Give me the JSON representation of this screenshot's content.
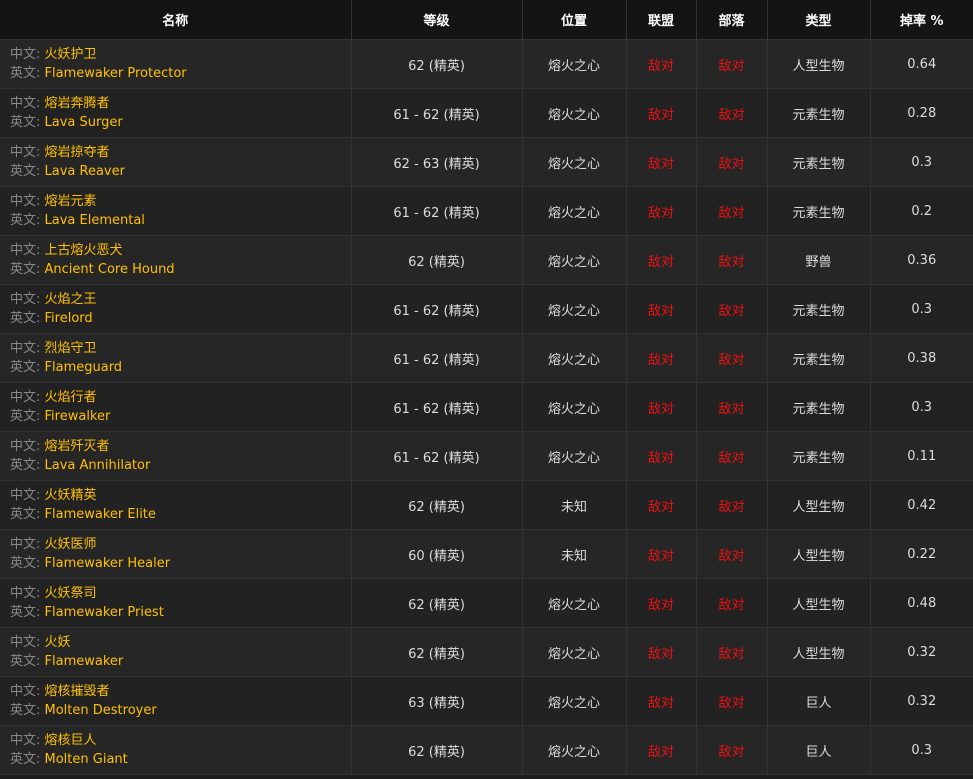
{
  "headers": {
    "name": "名称",
    "level": "等级",
    "location": "位置",
    "alliance": "联盟",
    "horde": "部落",
    "type": "类型",
    "drop": "掉率 %"
  },
  "labels": {
    "cn": "中文: ",
    "en": "英文: "
  },
  "colors": {
    "name": "#ffc000",
    "hostile": "#ee1111",
    "label": "#888888"
  },
  "rows": [
    {
      "cn": "火妖护卫",
      "en": "Flamewaker Protector",
      "level": "62 (精英)",
      "location": "熔火之心",
      "alliance": "敌对",
      "horde": "敌对",
      "type": "人型生物",
      "drop": "0.64"
    },
    {
      "cn": "熔岩奔腾者",
      "en": "Lava Surger",
      "level": "61 - 62 (精英)",
      "location": "熔火之心",
      "alliance": "敌对",
      "horde": "敌对",
      "type": "元素生物",
      "drop": "0.28"
    },
    {
      "cn": "熔岩掠夺者",
      "en": "Lava Reaver",
      "level": "62 - 63 (精英)",
      "location": "熔火之心",
      "alliance": "敌对",
      "horde": "敌对",
      "type": "元素生物",
      "drop": "0.3"
    },
    {
      "cn": "熔岩元素",
      "en": "Lava Elemental",
      "level": "61 - 62 (精英)",
      "location": "熔火之心",
      "alliance": "敌对",
      "horde": "敌对",
      "type": "元素生物",
      "drop": "0.2"
    },
    {
      "cn": "上古熔火恶犬",
      "en": "Ancient Core Hound",
      "level": "62 (精英)",
      "location": "熔火之心",
      "alliance": "敌对",
      "horde": "敌对",
      "type": "野兽",
      "drop": "0.36"
    },
    {
      "cn": "火焰之王",
      "en": "Firelord",
      "level": "61 - 62 (精英)",
      "location": "熔火之心",
      "alliance": "敌对",
      "horde": "敌对",
      "type": "元素生物",
      "drop": "0.3"
    },
    {
      "cn": "烈焰守卫",
      "en": "Flameguard",
      "level": "61 - 62 (精英)",
      "location": "熔火之心",
      "alliance": "敌对",
      "horde": "敌对",
      "type": "元素生物",
      "drop": "0.38"
    },
    {
      "cn": "火焰行者",
      "en": "Firewalker",
      "level": "61 - 62 (精英)",
      "location": "熔火之心",
      "alliance": "敌对",
      "horde": "敌对",
      "type": "元素生物",
      "drop": "0.3"
    },
    {
      "cn": "熔岩歼灭者",
      "en": "Lava Annihilator",
      "level": "61 - 62 (精英)",
      "location": "熔火之心",
      "alliance": "敌对",
      "horde": "敌对",
      "type": "元素生物",
      "drop": "0.11"
    },
    {
      "cn": "火妖精英",
      "en": "Flamewaker Elite",
      "level": "62 (精英)",
      "location": "未知",
      "alliance": "敌对",
      "horde": "敌对",
      "type": "人型生物",
      "drop": "0.42"
    },
    {
      "cn": "火妖医师",
      "en": "Flamewaker Healer",
      "level": "60 (精英)",
      "location": "未知",
      "alliance": "敌对",
      "horde": "敌对",
      "type": "人型生物",
      "drop": "0.22"
    },
    {
      "cn": "火妖祭司",
      "en": "Flamewaker Priest",
      "level": "62 (精英)",
      "location": "熔火之心",
      "alliance": "敌对",
      "horde": "敌对",
      "type": "人型生物",
      "drop": "0.48"
    },
    {
      "cn": "火妖",
      "en": "Flamewaker",
      "level": "62 (精英)",
      "location": "熔火之心",
      "alliance": "敌对",
      "horde": "敌对",
      "type": "人型生物",
      "drop": "0.32"
    },
    {
      "cn": "熔核摧毁者",
      "en": "Molten Destroyer",
      "level": "63 (精英)",
      "location": "熔火之心",
      "alliance": "敌对",
      "horde": "敌对",
      "type": "巨人",
      "drop": "0.32"
    },
    {
      "cn": "熔核巨人",
      "en": "Molten Giant",
      "level": "62 (精英)",
      "location": "熔火之心",
      "alliance": "敌对",
      "horde": "敌对",
      "type": "巨人",
      "drop": "0.3"
    }
  ]
}
